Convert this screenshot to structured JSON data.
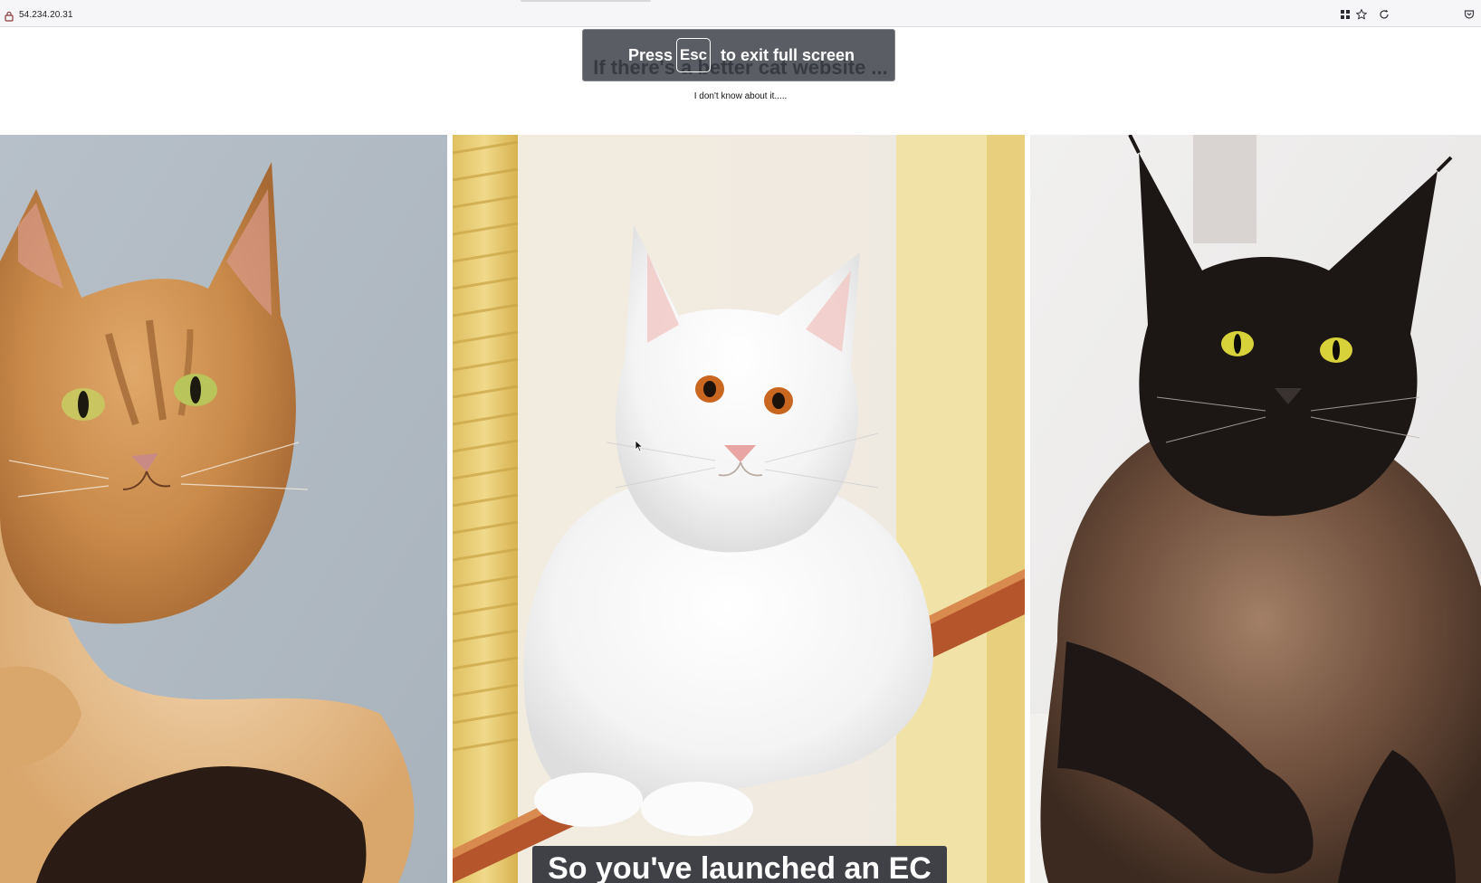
{
  "browser": {
    "url": "54.234.20.31",
    "icons": [
      "lock-icon",
      "grid-icon",
      "star-icon",
      "reload-icon",
      "pocket-icon"
    ]
  },
  "page": {
    "title": "If there's a better cat website ...",
    "subtitle": "I don't know about it....."
  },
  "fullscreen_notice": {
    "press": "Press",
    "key": "Esc",
    "rest": "to exit full screen"
  },
  "photos": [
    {
      "name": "orange-cat",
      "subject": "orange maine coon cat"
    },
    {
      "name": "white-cat",
      "subject": "white maine coon cat"
    },
    {
      "name": "black-cat",
      "subject": "black maine coon cat"
    }
  ],
  "caption": {
    "text": "So you've launched an EC"
  },
  "colors": {
    "toast_bg": "#3a3e46",
    "caption_bg": "#3f4147",
    "page_bg": "#ffffff"
  }
}
